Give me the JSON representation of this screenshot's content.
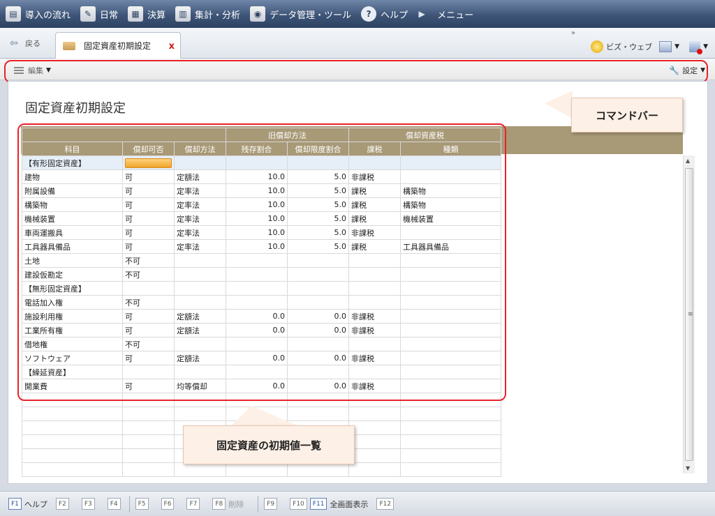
{
  "menubar": {
    "items": [
      {
        "label": "導入の流れ",
        "icon": "flow-icon"
      },
      {
        "label": "日常",
        "icon": "daily-icon"
      },
      {
        "label": "決算",
        "icon": "settlement-icon"
      },
      {
        "label": "集計・分析",
        "icon": "chart-icon"
      },
      {
        "label": "データ管理・ツール",
        "icon": "database-icon"
      },
      {
        "label": "ヘルプ",
        "icon": "help-icon"
      },
      {
        "label": "メニュー",
        "icon": "play-icon"
      }
    ]
  },
  "tabbar": {
    "back_label": "戻る",
    "tab_label": "固定資産初期設定",
    "close_glyph": "x",
    "overflow_glyph": "»",
    "bizweb_label": "ビズ・ウェブ"
  },
  "cmdbar": {
    "edit_label": "編集",
    "settings_label": "設定"
  },
  "page": {
    "title": "固定資産初期設定"
  },
  "callouts": {
    "command_bar": "コマンドバー",
    "table": "固定資産の初期値一覧"
  },
  "table": {
    "group_headers": {
      "old_method": "旧償却方法",
      "property_tax": "償却資産税"
    },
    "columns": [
      "科目",
      "償却可否",
      "償却方法",
      "残存割合",
      "償却限度割合",
      "課税",
      "種類"
    ],
    "rows": [
      [
        "【有形固定資産】",
        "",
        "",
        "",
        "",
        "",
        ""
      ],
      [
        "建物",
        "可",
        "定額法",
        "10.0",
        "5.0",
        "非課税",
        ""
      ],
      [
        "附属設備",
        "可",
        "定率法",
        "10.0",
        "5.0",
        "課税",
        "構築物"
      ],
      [
        "構築物",
        "可",
        "定率法",
        "10.0",
        "5.0",
        "課税",
        "構築物"
      ],
      [
        "機械装置",
        "可",
        "定率法",
        "10.0",
        "5.0",
        "課税",
        "機械装置"
      ],
      [
        "車両運搬具",
        "可",
        "定率法",
        "10.0",
        "5.0",
        "非課税",
        ""
      ],
      [
        "工具器具備品",
        "可",
        "定率法",
        "10.0",
        "5.0",
        "課税",
        "工具器具備品"
      ],
      [
        "土地",
        "不可",
        "",
        "",
        "",
        "",
        ""
      ],
      [
        "建設仮勘定",
        "不可",
        "",
        "",
        "",
        "",
        ""
      ],
      [
        "【無形固定資産】",
        "",
        "",
        "",
        "",
        "",
        ""
      ],
      [
        "電話加入権",
        "不可",
        "",
        "",
        "",
        "",
        ""
      ],
      [
        "施設利用権",
        "可",
        "定額法",
        "0.0",
        "0.0",
        "非課税",
        ""
      ],
      [
        "工業所有権",
        "可",
        "定額法",
        "0.0",
        "0.0",
        "非課税",
        ""
      ],
      [
        "借地権",
        "不可",
        "",
        "",
        "",
        "",
        ""
      ],
      [
        "ソフトウェア",
        "可",
        "定額法",
        "0.0",
        "0.0",
        "非課税",
        ""
      ],
      [
        "【繰延資産】",
        "",
        "",
        "",
        "",
        "",
        ""
      ],
      [
        "開業費",
        "可",
        "均等償却",
        "0.0",
        "0.0",
        "非課税",
        ""
      ]
    ]
  },
  "fkeys": [
    {
      "key": "F1",
      "label": "ヘルプ"
    },
    {
      "key": "F2",
      "label": ""
    },
    {
      "key": "F3",
      "label": ""
    },
    {
      "key": "F4",
      "label": ""
    },
    {
      "key": "F5",
      "label": ""
    },
    {
      "key": "F6",
      "label": ""
    },
    {
      "key": "F7",
      "label": ""
    },
    {
      "key": "F8",
      "label": "削除"
    },
    {
      "key": "F9",
      "label": ""
    },
    {
      "key": "F10",
      "label": ""
    },
    {
      "key": "F11",
      "label": "全画面表示"
    },
    {
      "key": "F12",
      "label": ""
    }
  ],
  "colors": {
    "header_brown": "#a89977",
    "highlight_red": "#e8222a",
    "selection_orange": "#f0a52a",
    "callout_bg": "#fdf0e6"
  }
}
